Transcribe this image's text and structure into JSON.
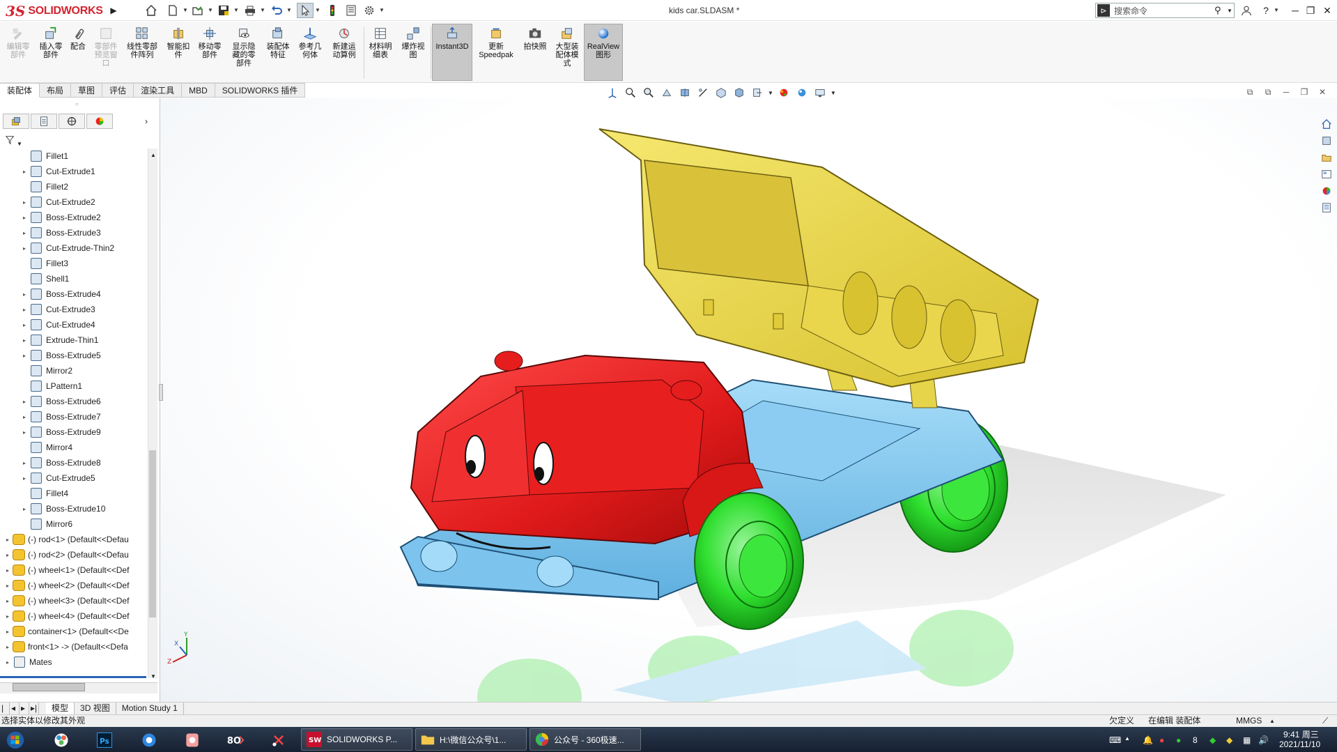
{
  "app": {
    "logo_ds": "3S",
    "logo_text": "SOLIDWORKS",
    "document_title": "kids car.SLDASM *",
    "search_placeholder": "搜索命令"
  },
  "quick_access": [
    {
      "name": "home-icon"
    },
    {
      "name": "new-document-icon"
    },
    {
      "name": "open-icon"
    },
    {
      "name": "save-icon"
    },
    {
      "name": "print-icon"
    },
    {
      "name": "undo-icon"
    },
    {
      "name": "select-arrow-icon"
    },
    {
      "name": "rebuild-traffic-light-icon"
    },
    {
      "name": "file-properties-icon"
    },
    {
      "name": "options-gear-icon"
    }
  ],
  "ribbon": {
    "buttons": [
      {
        "id": "edit-component",
        "label": "编辑零\n部件",
        "disabled": true,
        "icon": "edit-component-icon"
      },
      {
        "id": "insert-component",
        "label": "插入零\n部件",
        "disabled": false,
        "icon": "insert-component-icon"
      },
      {
        "id": "mate",
        "label": "配合",
        "disabled": false,
        "icon": "mate-paperclip-icon"
      },
      {
        "id": "component-preview",
        "label": "零部件\n预览窗\n口",
        "disabled": true,
        "icon": "preview-window-icon"
      },
      {
        "id": "linear-pattern",
        "label": "线性零部\n件阵列",
        "disabled": false,
        "icon": "linear-pattern-icon"
      },
      {
        "id": "smart-fasteners",
        "label": "智能扣\n件",
        "disabled": false,
        "icon": "smart-fastener-icon"
      },
      {
        "id": "move-component",
        "label": "移动零\n部件",
        "disabled": false,
        "icon": "move-component-icon"
      },
      {
        "id": "show-hidden",
        "label": "显示隐\n藏的零\n部件",
        "disabled": false,
        "icon": "show-hidden-icon"
      },
      {
        "id": "assembly-features",
        "label": "装配体\n特征",
        "disabled": false,
        "icon": "assembly-feature-icon"
      },
      {
        "id": "reference-geometry",
        "label": "参考几\n何体",
        "disabled": false,
        "icon": "reference-geometry-icon"
      },
      {
        "id": "new-motion-study",
        "label": "新建运\n动算例",
        "disabled": false,
        "icon": "motion-study-icon"
      },
      {
        "id": "bom",
        "label": "材料明\n细表",
        "disabled": false,
        "icon": "bom-table-icon"
      },
      {
        "id": "exploded-view",
        "label": "爆炸视\n图",
        "disabled": false,
        "icon": "exploded-view-icon"
      },
      {
        "id": "instant3d",
        "label": "Instant3D",
        "disabled": false,
        "active": true,
        "icon": "instant3d-icon"
      },
      {
        "id": "update-speedpak",
        "label": "更新\nSpeedpak",
        "disabled": false,
        "icon": "speedpak-icon"
      },
      {
        "id": "snapshot",
        "label": "拍快照",
        "disabled": false,
        "icon": "camera-icon"
      },
      {
        "id": "large-assembly",
        "label": "大型装\n配体模\n式",
        "disabled": false,
        "icon": "large-assembly-icon"
      },
      {
        "id": "realview",
        "label": "RealView\n图形",
        "disabled": false,
        "active": true,
        "icon": "realview-sphere-icon"
      }
    ]
  },
  "command_tabs": [
    "装配体",
    "布局",
    "草图",
    "评估",
    "渲染工具",
    "MBD",
    "SOLIDWORKS 插件"
  ],
  "tree_items": [
    {
      "label": "Fillet1",
      "expand": false,
      "type": "feature"
    },
    {
      "label": "Cut-Extrude1",
      "expand": true,
      "type": "feature"
    },
    {
      "label": "Fillet2",
      "expand": false,
      "type": "feature"
    },
    {
      "label": "Cut-Extrude2",
      "expand": true,
      "type": "feature"
    },
    {
      "label": "Boss-Extrude2",
      "expand": true,
      "type": "feature"
    },
    {
      "label": "Boss-Extrude3",
      "expand": true,
      "type": "feature"
    },
    {
      "label": "Cut-Extrude-Thin2",
      "expand": true,
      "type": "feature"
    },
    {
      "label": "Fillet3",
      "expand": false,
      "type": "feature"
    },
    {
      "label": "Shell1",
      "expand": false,
      "type": "feature"
    },
    {
      "label": "Boss-Extrude4",
      "expand": true,
      "type": "feature"
    },
    {
      "label": "Cut-Extrude3",
      "expand": true,
      "type": "feature"
    },
    {
      "label": "Cut-Extrude4",
      "expand": true,
      "type": "feature"
    },
    {
      "label": "Extrude-Thin1",
      "expand": true,
      "type": "feature"
    },
    {
      "label": "Boss-Extrude5",
      "expand": true,
      "type": "feature"
    },
    {
      "label": "Mirror2",
      "expand": false,
      "type": "feature"
    },
    {
      "label": "LPattern1",
      "expand": false,
      "type": "feature"
    },
    {
      "label": "Boss-Extrude6",
      "expand": true,
      "type": "feature"
    },
    {
      "label": "Boss-Extrude7",
      "expand": true,
      "type": "feature"
    },
    {
      "label": "Boss-Extrude9",
      "expand": true,
      "type": "feature"
    },
    {
      "label": "Mirror4",
      "expand": false,
      "type": "feature"
    },
    {
      "label": "Boss-Extrude8",
      "expand": true,
      "type": "feature"
    },
    {
      "label": "Cut-Extrude5",
      "expand": true,
      "type": "feature"
    },
    {
      "label": "Fillet4",
      "expand": false,
      "type": "feature"
    },
    {
      "label": "Boss-Extrude10",
      "expand": true,
      "type": "feature"
    },
    {
      "label": "Mirror6",
      "expand": false,
      "type": "feature"
    },
    {
      "label": "(-) rod<1> (Default<<Defau",
      "expand": true,
      "type": "component"
    },
    {
      "label": "(-) rod<2> (Default<<Defau",
      "expand": true,
      "type": "component"
    },
    {
      "label": "(-) wheel<1> (Default<<Def",
      "expand": true,
      "type": "component"
    },
    {
      "label": "(-) wheel<2> (Default<<Def",
      "expand": true,
      "type": "component"
    },
    {
      "label": "(-) wheel<3> (Default<<Def",
      "expand": true,
      "type": "component"
    },
    {
      "label": "(-) wheel<4> (Default<<Def",
      "expand": true,
      "type": "component"
    },
    {
      "label": "container<1> (Default<<De",
      "expand": true,
      "type": "component"
    },
    {
      "label": "front<1> -> (Default<<Defa",
      "expand": true,
      "type": "component"
    },
    {
      "label": "Mates",
      "expand": true,
      "type": "mates"
    }
  ],
  "bottom_tabs": [
    "模型",
    "3D 视图",
    "Motion Study 1"
  ],
  "status": {
    "left": "选择实体以修改其外观",
    "underdefined": "欠定义",
    "editing": "在编辑 装配体",
    "units": "MMGS"
  },
  "taskbar": {
    "windows": [
      {
        "label": "SOLIDWORKS P...",
        "icon": "solidworks-icon"
      },
      {
        "label": "H:\\微信公众号\\1...",
        "icon": "folder-icon"
      },
      {
        "label": "公众号 - 360极速...",
        "icon": "browser-360-icon"
      }
    ],
    "time": "9:41 周三",
    "date": "2021/11/10"
  },
  "colors": {
    "accent_red": "#d3232e",
    "truck_red": "#e01a1a",
    "truck_blue": "#7cc4ee",
    "truck_yellow": "#ecd84a",
    "wheel_green": "#2fdf2f"
  }
}
